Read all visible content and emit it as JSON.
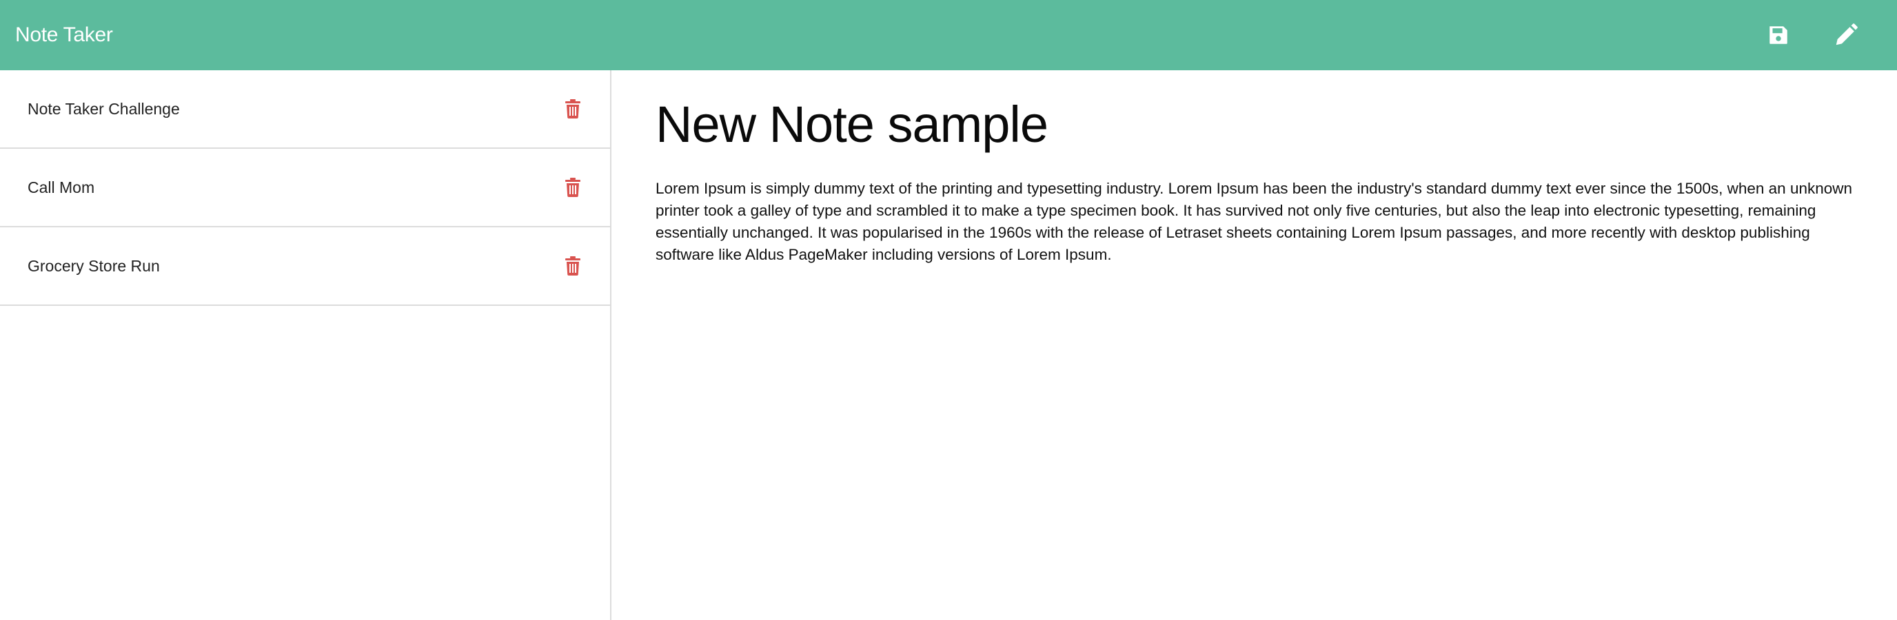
{
  "app": {
    "title": "Note Taker",
    "accent_color": "#5cbb9d",
    "delete_color": "#d9534f"
  },
  "navbar": {
    "save_icon": "floppy-disk-icon",
    "new_note_icon": "pencil-icon"
  },
  "sidebar": {
    "notes": [
      {
        "title": "Note Taker Challenge",
        "icon": "trash-icon"
      },
      {
        "title": "Call Mom",
        "icon": "trash-icon"
      },
      {
        "title": "Grocery Store Run",
        "icon": "trash-icon"
      }
    ]
  },
  "editor": {
    "title": "New Note sample",
    "body": "Lorem Ipsum is simply dummy text of the printing and typesetting industry. Lorem Ipsum has been the industry's standard dummy text ever since the 1500s, when an unknown printer took a galley of type and scrambled it to make a type specimen book. It has survived not only five centuries, but also the leap into electronic typesetting, remaining essentially unchanged. It was popularised in the 1960s with the release of Letraset sheets containing Lorem Ipsum passages, and more recently with desktop publishing software like Aldus PageMaker including versions of Lorem Ipsum."
  }
}
